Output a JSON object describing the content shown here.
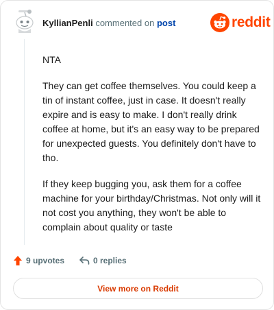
{
  "comment": {
    "author": "KyllianPenli",
    "action_text": "commented on",
    "post_link_label": "post",
    "paragraphs": [
      "NTA",
      "They can get coffee themselves. You could keep a tin of instant coffee, just in case. It doesn't really expire and is easy to make. I don't really drink coffee at home, but it's an easy way to be prepared for unexpected guests. You definitely don't have to tho.",
      "If they keep bugging you, ask them for a coffee machine for your birthday/Christmas. Not only will it not cost you anything, they won't be able to complain about quality or taste"
    ]
  },
  "brand": {
    "wordmark": "reddit",
    "color": "#ff4500"
  },
  "footer": {
    "upvotes_label": "9 upvotes",
    "replies_label": "0 replies",
    "upvote_icon": "arrow-up-icon",
    "reply_icon": "reply-arrow-icon",
    "upvote_color": "#ff4500"
  },
  "actions": {
    "view_more_label": "View more on Reddit"
  }
}
